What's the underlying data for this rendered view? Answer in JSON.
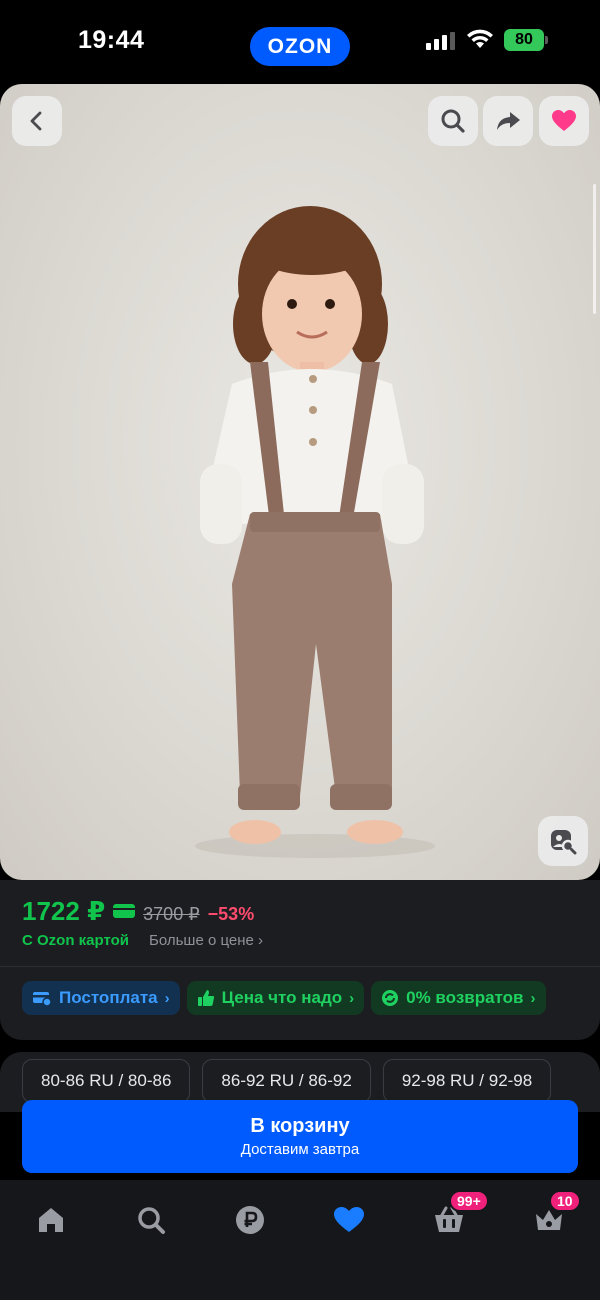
{
  "status_bar": {
    "time": "19:44",
    "brand": "OZON",
    "battery": "80"
  },
  "photo": {
    "back_icon": "chevron-left-icon",
    "search_icon": "search-icon",
    "share_icon": "share-arrow-icon",
    "favorite_icon": "heart-icon",
    "favorite_color": "#ff3a8a",
    "lens_icon": "image-search-icon",
    "background_color": "#e3e0da"
  },
  "price": {
    "current": "1722 ₽",
    "old": "3700 ₽",
    "discount": "−53%",
    "ozon_card_label": "С Ozon картой",
    "more_label": "Больше о цене ›"
  },
  "chips": [
    {
      "label": "Постоплата",
      "icon": "postpay-icon",
      "style": "blue"
    },
    {
      "label": "Цена что надо",
      "icon": "thumbs-up-icon",
      "style": "green"
    },
    {
      "label": "0% возвратов",
      "icon": "return-icon",
      "style": "green"
    }
  ],
  "sizes": [
    "80-86 RU / 80-86",
    "86-92 RU / 86-92",
    "92-98 RU / 92-98"
  ],
  "cart": {
    "title": "В корзину",
    "subtitle": "Доставим завтра"
  },
  "nav": {
    "items": [
      {
        "icon": "home-icon"
      },
      {
        "icon": "search-icon"
      },
      {
        "icon": "ruble-icon"
      },
      {
        "icon": "heart-icon"
      },
      {
        "icon": "cart-icon",
        "badge": "99+"
      },
      {
        "icon": "profile-crown-icon",
        "badge": "10"
      }
    ]
  },
  "colors": {
    "accent_blue": "#005bff",
    "price_green": "#10c44c",
    "discount_pink": "#ff4b6e",
    "badge_pink": "#f0217a"
  }
}
